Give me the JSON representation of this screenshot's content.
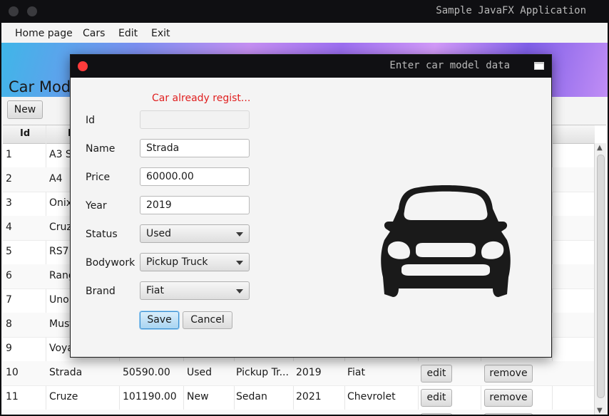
{
  "window": {
    "title": "Sample JavaFX Application"
  },
  "menu": [
    "Home page",
    "Cars",
    "Edit",
    "Exit"
  ],
  "page": {
    "title": "Car Models",
    "new_button": "New"
  },
  "table": {
    "headers": [
      "Id",
      "N"
    ],
    "rows": [
      {
        "id": "1",
        "name": "A3 S"
      },
      {
        "id": "2",
        "name": "A4"
      },
      {
        "id": "3",
        "name": "Onix"
      },
      {
        "id": "4",
        "name": "Cruz"
      },
      {
        "id": "5",
        "name": "RS7"
      },
      {
        "id": "6",
        "name": "Rang"
      },
      {
        "id": "7",
        "name": "Uno"
      },
      {
        "id": "8",
        "name": "Must"
      },
      {
        "id": "9",
        "name": "Voya"
      },
      {
        "id": "10",
        "name": "Strada",
        "price": "50590.00",
        "status": "Used",
        "bodywork": "Pickup Tr...",
        "year": "2019",
        "brand": "Fiat",
        "edit": "edit",
        "remove": "remove"
      },
      {
        "id": "11",
        "name": "Cruze",
        "price": "101190.00",
        "status": "New",
        "bodywork": "Sedan",
        "year": "2021",
        "brand": "Chevrolet",
        "edit": "edit",
        "remove": "remove"
      }
    ]
  },
  "dialog": {
    "title": "Enter car model data",
    "error": "Car already regist...",
    "labels": {
      "id": "Id",
      "name": "Name",
      "price": "Price",
      "year": "Year",
      "status": "Status",
      "bodywork": "Bodywork",
      "brand": "Brand"
    },
    "values": {
      "id": "",
      "name": "Strada",
      "price": "60000.00",
      "year": "2019",
      "status": "Used",
      "bodywork": "Pickup Truck",
      "brand": "Fiat"
    },
    "save_label": "Save",
    "cancel_label": "Cancel",
    "icon": "car-front-icon",
    "error_color": "#e02020",
    "accent_color": "#3a8fd0"
  }
}
